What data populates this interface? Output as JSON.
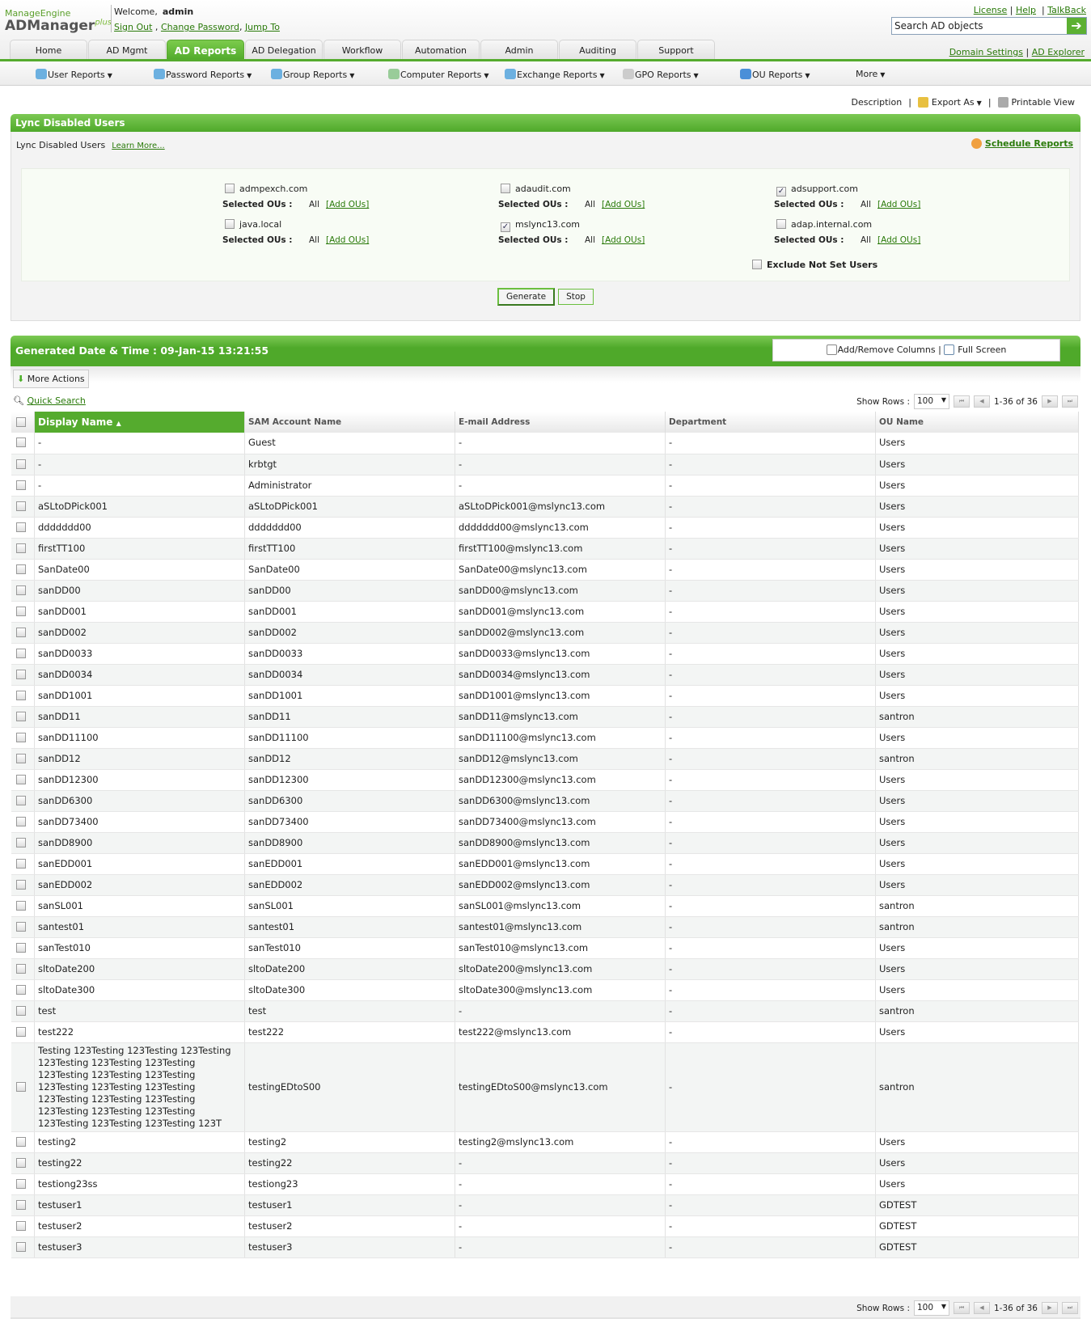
{
  "header": {
    "logo_top": "ManageEngine",
    "logo_main": "ADManager",
    "logo_sup": "plus",
    "welcome": "Welcome,",
    "user": "admin",
    "sign_out": "Sign Out",
    "change_password": "Change Password",
    "jump_to": "Jump To",
    "license": "License",
    "help": "Help",
    "talkback": "TalkBack",
    "search_placeholder": "Search AD objects",
    "domain_settings": "Domain Settings",
    "ad_explorer": "AD Explorer"
  },
  "tabs": [
    "Home",
    "AD Mgmt",
    "AD Reports",
    "AD Delegation",
    "Workflow",
    "Automation",
    "Admin",
    "Auditing",
    "Support"
  ],
  "subnav": [
    "User Reports",
    "Password Reports",
    "Group Reports",
    "Computer Reports",
    "Exchange Reports",
    "GPO Reports",
    "OU Reports",
    "More"
  ],
  "tools": {
    "description": "Description",
    "export": "Export As",
    "printable": "Printable View"
  },
  "report": {
    "title": "Lync Disabled Users",
    "subtitle": "Lync Disabled Users",
    "learn_more": "Learn More...",
    "schedule": "Schedule Reports",
    "selected_ous_label": "Selected OUs :",
    "all": "All",
    "add_ous": "[Add OUs]",
    "exclude": "Exclude Not Set Users",
    "generate": "Generate",
    "stop": "Stop",
    "domains": [
      {
        "name": "admpexch.com",
        "checked": false
      },
      {
        "name": "adaudit.com",
        "checked": false
      },
      {
        "name": "adsupport.com",
        "checked": true
      },
      {
        "name": "java.local",
        "checked": false
      },
      {
        "name": "mslync13.com",
        "checked": true
      },
      {
        "name": "adap.internal.com",
        "checked": false
      }
    ]
  },
  "results": {
    "generated": "Generated Date & Time : 09-Jan-15 13:21:55",
    "add_remove": "Add/Remove Columns",
    "full_screen": "Full Screen",
    "more_actions": "More Actions",
    "quick_search": "Quick Search",
    "show_rows": "Show Rows :",
    "rows_value": "100",
    "range": "1-36 of 36",
    "columns": [
      "Display Name",
      "SAM Account Name",
      "E-mail Address",
      "Department",
      "OU Name"
    ],
    "rows": [
      [
        "-",
        "Guest",
        "-",
        "-",
        "Users"
      ],
      [
        "-",
        "krbtgt",
        "-",
        "-",
        "Users"
      ],
      [
        "-",
        "Administrator",
        "-",
        "-",
        "Users"
      ],
      [
        "aSLtoDPick001",
        "aSLtoDPick001",
        "aSLtoDPick001@mslync13.com",
        "-",
        "Users"
      ],
      [
        "ddddddd00",
        "ddddddd00",
        "ddddddd00@mslync13.com",
        "-",
        "Users"
      ],
      [
        "firstTT100",
        "firstTT100",
        "firstTT100@mslync13.com",
        "-",
        "Users"
      ],
      [
        "SanDate00",
        "SanDate00",
        "SanDate00@mslync13.com",
        "-",
        "Users"
      ],
      [
        "sanDD00",
        "sanDD00",
        "sanDD00@mslync13.com",
        "-",
        "Users"
      ],
      [
        "sanDD001",
        "sanDD001",
        "sanDD001@mslync13.com",
        "-",
        "Users"
      ],
      [
        "sanDD002",
        "sanDD002",
        "sanDD002@mslync13.com",
        "-",
        "Users"
      ],
      [
        "sanDD0033",
        "sanDD0033",
        "sanDD0033@mslync13.com",
        "-",
        "Users"
      ],
      [
        "sanDD0034",
        "sanDD0034",
        "sanDD0034@mslync13.com",
        "-",
        "Users"
      ],
      [
        "sanDD1001",
        "sanDD1001",
        "sanDD1001@mslync13.com",
        "-",
        "Users"
      ],
      [
        "sanDD11",
        "sanDD11",
        "sanDD11@mslync13.com",
        "-",
        "santron"
      ],
      [
        "sanDD11100",
        "sanDD11100",
        "sanDD11100@mslync13.com",
        "-",
        "Users"
      ],
      [
        "sanDD12",
        "sanDD12",
        "sanDD12@mslync13.com",
        "-",
        "santron"
      ],
      [
        "sanDD12300",
        "sanDD12300",
        "sanDD12300@mslync13.com",
        "-",
        "Users"
      ],
      [
        "sanDD6300",
        "sanDD6300",
        "sanDD6300@mslync13.com",
        "-",
        "Users"
      ],
      [
        "sanDD73400",
        "sanDD73400",
        "sanDD73400@mslync13.com",
        "-",
        "Users"
      ],
      [
        "sanDD8900",
        "sanDD8900",
        "sanDD8900@mslync13.com",
        "-",
        "Users"
      ],
      [
        "sanEDD001",
        "sanEDD001",
        "sanEDD001@mslync13.com",
        "-",
        "Users"
      ],
      [
        "sanEDD002",
        "sanEDD002",
        "sanEDD002@mslync13.com",
        "-",
        "Users"
      ],
      [
        "sanSL001",
        "sanSL001",
        "sanSL001@mslync13.com",
        "-",
        "santron"
      ],
      [
        "santest01",
        "santest01",
        "santest01@mslync13.com",
        "-",
        "santron"
      ],
      [
        "sanTest010",
        "sanTest010",
        "sanTest010@mslync13.com",
        "-",
        "Users"
      ],
      [
        "sltoDate200",
        "sltoDate200",
        "sltoDate200@mslync13.com",
        "-",
        "Users"
      ],
      [
        "sltoDate300",
        "sltoDate300",
        "sltoDate300@mslync13.com",
        "-",
        "Users"
      ],
      [
        "test",
        "test",
        "-",
        "-",
        "santron"
      ],
      [
        "test222",
        "test222",
        "test222@mslync13.com",
        "-",
        "Users"
      ],
      [
        "Testing 123Testing 123Testing 123Testing 123Testing 123Testing 123Testing 123Testing 123Testing 123Testing 123Testing 123Testing 123Testing 123Testing 123Testing 123Testing 123Testing 123Testing 123Testing 123Testing 123Testing 123Testing 123T",
        "testingEDtoS00",
        "testingEDtoS00@mslync13.com",
        "-",
        "santron"
      ],
      [
        "testing2",
        "testing2",
        "testing2@mslync13.com",
        "-",
        "Users"
      ],
      [
        "testing22",
        "testing22",
        "-",
        "-",
        "Users"
      ],
      [
        "testiong23ss",
        "testiong23",
        "-",
        "-",
        "Users"
      ],
      [
        "testuser1",
        "testuser1",
        "-",
        "-",
        "GDTEST"
      ],
      [
        "testuser2",
        "testuser2",
        "-",
        "-",
        "GDTEST"
      ],
      [
        "testuser3",
        "testuser3",
        "-",
        "-",
        "GDTEST"
      ]
    ]
  },
  "colors": {
    "brand_green": "#55ab2e",
    "link_green": "#2a7a0a"
  }
}
